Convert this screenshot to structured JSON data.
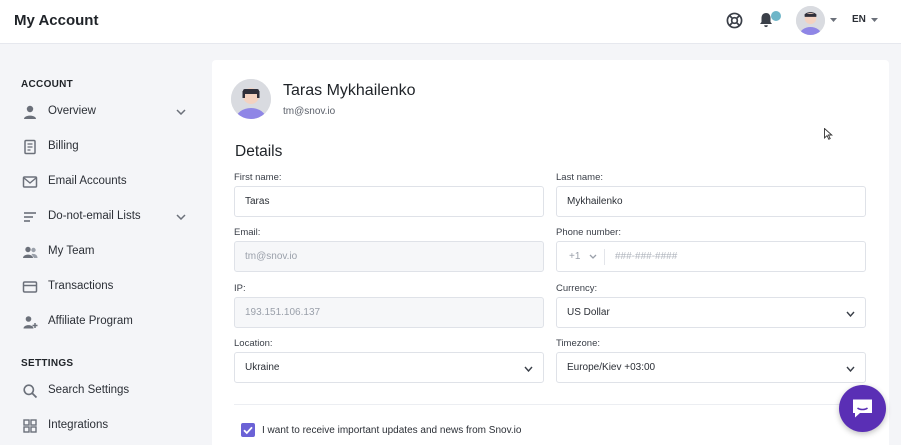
{
  "header": {
    "title": "My Account",
    "lang": "EN"
  },
  "sidebar": {
    "account_title": "ACCOUNT",
    "settings_title": "SETTINGS",
    "items": [
      {
        "label": "Overview",
        "icon": "user-icon"
      },
      {
        "label": "Billing",
        "icon": "document-icon"
      },
      {
        "label": "Email Accounts",
        "icon": "envelope-icon"
      },
      {
        "label": "Do-not-email Lists",
        "icon": "list-icon"
      },
      {
        "label": "My Team",
        "icon": "team-icon"
      },
      {
        "label": "Transactions",
        "icon": "credit-card-icon"
      },
      {
        "label": "Affiliate Program",
        "icon": "user-plus-icon"
      }
    ],
    "settings_items": [
      {
        "label": "Search Settings",
        "icon": "search-icon"
      },
      {
        "label": "Integrations",
        "icon": "grid-icon"
      }
    ]
  },
  "profile": {
    "name": "Taras Mykhailenko",
    "email": "tm@snov.io"
  },
  "details": {
    "title": "Details",
    "first_name_label": "First name:",
    "first_name": "Taras",
    "last_name_label": "Last name:",
    "last_name": "Mykhailenko",
    "email_label": "Email:",
    "email": "tm@snov.io",
    "phone_label": "Phone number:",
    "phone_code": "+1",
    "phone_placeholder": "###-###-####",
    "ip_label": "IP:",
    "ip": "193.151.106.137",
    "currency_label": "Currency:",
    "currency": "US Dollar",
    "location_label": "Location:",
    "location": "Ukraine",
    "timezone_label": "Timezone:",
    "timezone": "Europe/Kiev +03:00"
  },
  "newsletter": {
    "label": "I want to receive important updates and news from Snov.io",
    "checked": true
  },
  "colors": {
    "accent": "#6b62d6",
    "chat": "#5a2fb5",
    "notification_dot": "#6fb6c8"
  }
}
